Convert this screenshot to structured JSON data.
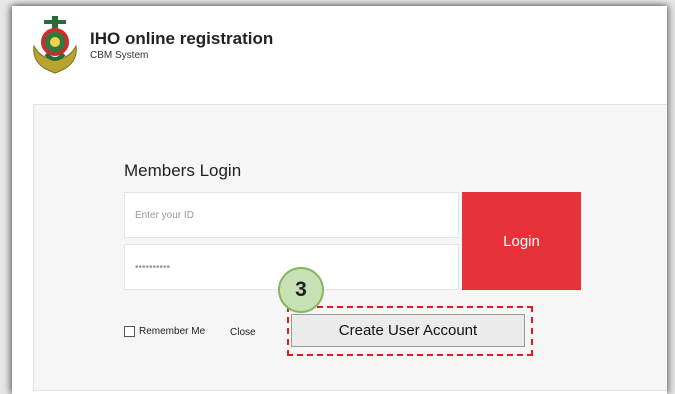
{
  "header": {
    "title": "IHO online registration",
    "subtitle": "CBM System"
  },
  "login": {
    "heading": "Members Login",
    "id_placeholder": "Enter your ID",
    "password_value": "••••••••••",
    "login_label": "Login",
    "remember_label": "Remember Me",
    "close_label": "Close",
    "create_account_label": "Create User Account"
  },
  "annotation": {
    "step_number": "3",
    "highlight_color": "#e01b1b",
    "badge_color": "#c8e1b4"
  },
  "colors": {
    "login_button": "#e8323a"
  }
}
